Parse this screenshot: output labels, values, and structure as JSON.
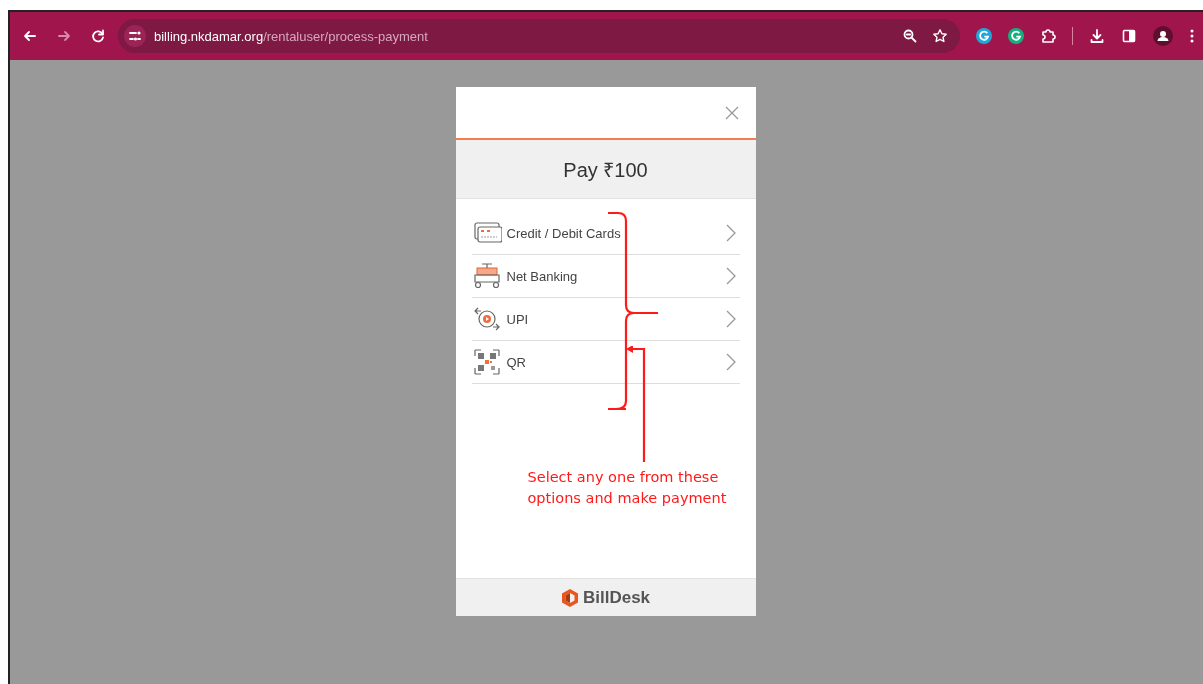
{
  "browser": {
    "url_host": "billing.nkdamar.org",
    "url_path": "/rentaluser/process-payment"
  },
  "modal": {
    "amount_title": "Pay ₹100",
    "options": [
      {
        "label": "Credit / Debit Cards",
        "kind": "card"
      },
      {
        "label": "Net Banking",
        "kind": "bank"
      },
      {
        "label": "UPI",
        "kind": "upi"
      },
      {
        "label": "QR",
        "kind": "qr"
      }
    ],
    "brand": "BillDesk"
  },
  "annotation": {
    "text": "Select any one from these options and make payment"
  }
}
